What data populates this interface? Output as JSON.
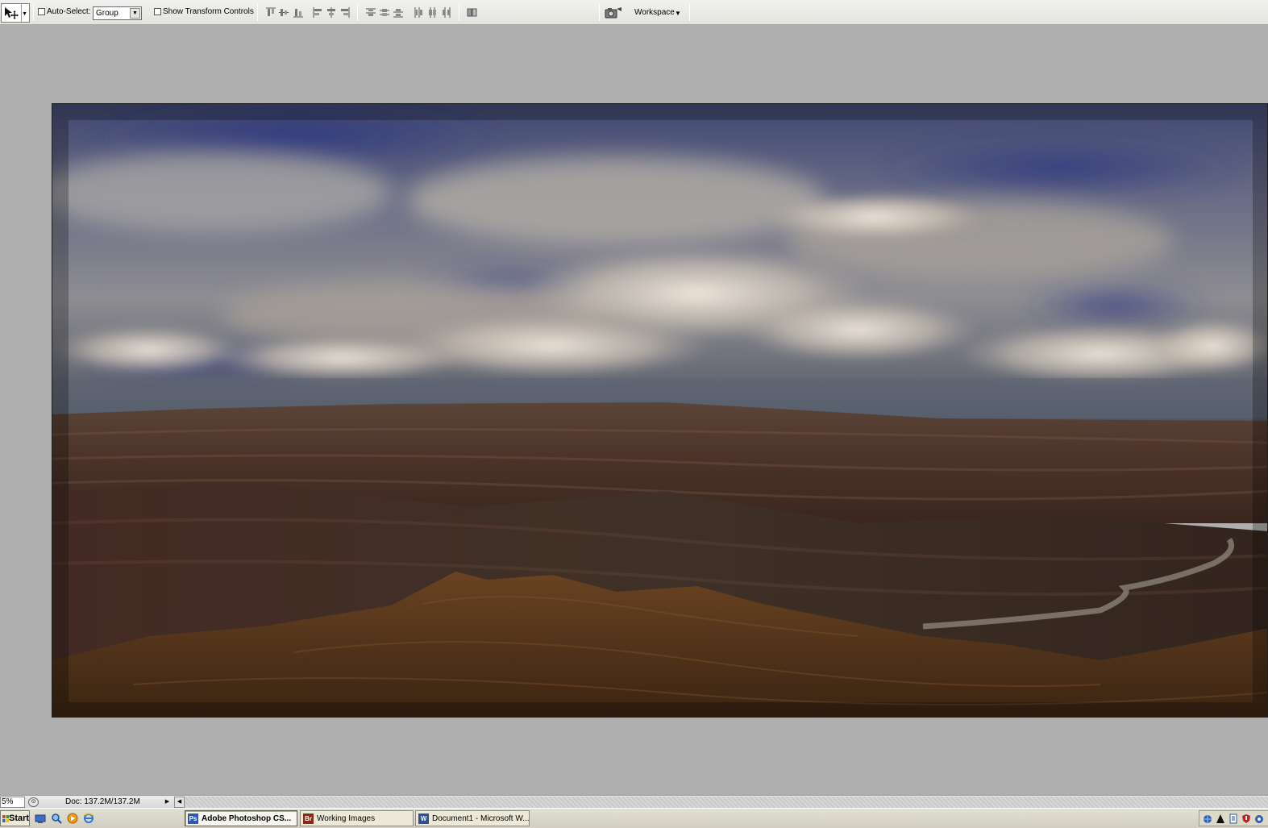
{
  "options_bar": {
    "auto_select_label": "Auto-Select:",
    "auto_select_checked": false,
    "group_select_value": "Group",
    "show_transform_label": "Show Transform Controls",
    "show_transform_checked": false,
    "workspace_label": "Workspace"
  },
  "document": {
    "image_subject": "grand-canyon-landscape"
  },
  "status_bar": {
    "zoom": "5%",
    "doc_info": "Doc: 137.2M/137.2M"
  },
  "taskbar": {
    "start_label": "Start",
    "tasks": [
      {
        "label": "Adobe Photoshop CS...",
        "icon": "Ps",
        "active": true,
        "icon_color": "#2a5bb4"
      },
      {
        "label": "Working Images",
        "icon": "Br",
        "active": false,
        "icon_color": "#8b2a14"
      },
      {
        "label": "Document1 - Microsoft W...",
        "icon": "W",
        "active": false,
        "icon_color": "#2a4f9e"
      }
    ]
  },
  "colors": {
    "app_background": "#afafaf",
    "options_bar": "#e8e7e2",
    "taskbar": "#d6d3c6"
  }
}
